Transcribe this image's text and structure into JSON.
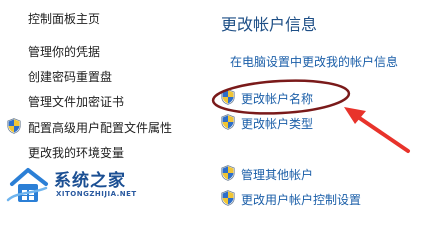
{
  "left_nav": {
    "home_label": "控制面板主页",
    "items": [
      {
        "label": "管理你的凭据",
        "shield": false
      },
      {
        "label": "创建密码重置盘",
        "shield": false
      },
      {
        "label": "管理文件加密证书",
        "shield": false
      },
      {
        "label": "配置高级用户配置文件属性",
        "shield": true
      },
      {
        "label": "更改我的环境变量",
        "shield": false
      }
    ]
  },
  "main": {
    "heading": "更改帐户信息",
    "links": [
      {
        "label": "在电脑设置中更改我的帐户信息",
        "shield": false
      },
      {
        "label": "更改帐户名称",
        "shield": true
      },
      {
        "label": "更改帐户类型",
        "shield": true
      },
      {
        "label": "管理其他帐户",
        "shield": true
      },
      {
        "label": "更改用户帐户控制设置",
        "shield": true
      }
    ]
  },
  "watermark": {
    "title": "系统之家",
    "url": "XITONGZHIJIA.NET"
  },
  "colors": {
    "annotation": "#7a1a1a",
    "arrow": "#e8332b",
    "link": "#1a5ea8",
    "heading": "#1e4f86"
  }
}
